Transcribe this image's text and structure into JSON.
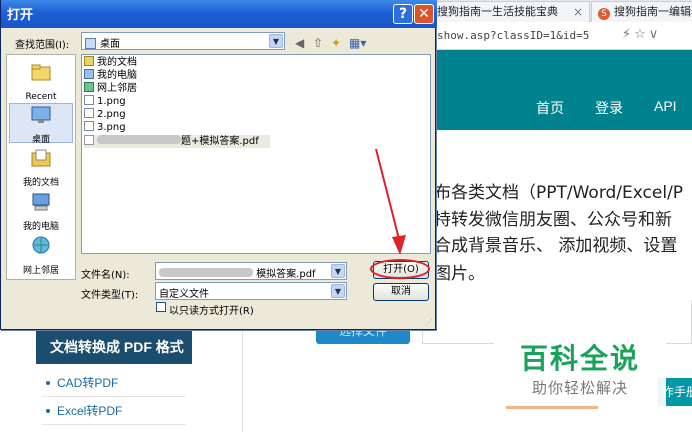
{
  "browser": {
    "tabs": [
      {
        "label": "搜狗指南一生活技能宝典",
        "close": "×",
        "favicon": ""
      },
      {
        "label": "搜狗指南一编辑器",
        "close": "",
        "favicon": "S"
      }
    ],
    "address_fragment": "show.asp?classID=1&id=5",
    "address_icons": "⚡☆∨"
  },
  "site": {
    "nav": [
      "首页",
      "登录",
      "API"
    ],
    "main_lines": [
      "布各类文档（PPT/Word/Excel/P",
      "持转发微信朋友圈、公众号和新",
      "合成背景音乐、 添加视频、设置",
      "图片。"
    ],
    "upload_button": "选择文件",
    "sidebar_title": "文档转换成 PDF 格式",
    "sidebar_items": [
      "CAD转PDF",
      "Excel转PDF"
    ],
    "right_button": "作手册",
    "watermark_title": "百科全说",
    "watermark_sub": "助你轻松解决"
  },
  "dialog": {
    "title": "打开",
    "help_glyph": "?",
    "close_glyph": "✕",
    "lookin_label": "查找范围(I):",
    "lookin_value": "桌面",
    "places": [
      {
        "label": "Recent",
        "icon": "recent-folder-icon"
      },
      {
        "label": "桌面",
        "icon": "desktop-icon",
        "selected": true
      },
      {
        "label": "我的文档",
        "icon": "my-documents-icon"
      },
      {
        "label": "我的电脑",
        "icon": "my-computer-icon"
      },
      {
        "label": "网上邻居",
        "icon": "network-icon"
      }
    ],
    "files": [
      {
        "name": "我的文档",
        "icon": "doc"
      },
      {
        "name": "我的电脑",
        "icon": "pc"
      },
      {
        "name": "网上邻居",
        "icon": "net"
      },
      {
        "name": "1.png",
        "icon": "png"
      },
      {
        "name": "2.png",
        "icon": "png"
      },
      {
        "name": "3.png",
        "icon": "png"
      },
      {
        "name": "题+模拟答案.pdf",
        "icon": "pdf"
      }
    ],
    "filename_label": "文件名(N):",
    "filename_value": "模拟答案.pdf",
    "filetype_label": "文件类型(T):",
    "filetype_value": "自定义文件",
    "readonly_label": "以只读方式打开(R)",
    "open_button": "打开(O)",
    "cancel_button": "取消"
  },
  "colors": {
    "site_header": "#00838f",
    "dialog_title": "#1f5fd6",
    "annotation": "#e0202a",
    "watermark": "#1aa15a"
  }
}
